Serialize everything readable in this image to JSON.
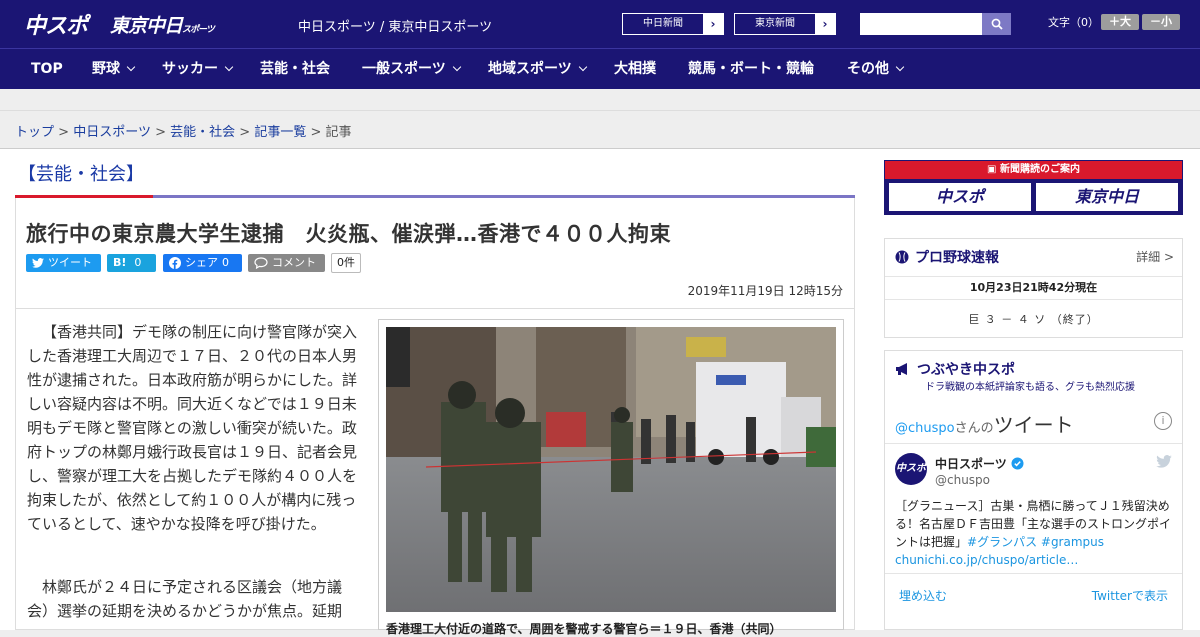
{
  "header": {
    "logo_chuspo": "中スポ",
    "logo_tokyo": "東京中日",
    "logo_tokyo_small": "スポーツ",
    "site_name": "中日スポーツ / 東京中日スポーツ",
    "ext_links": [
      "中日新聞",
      "東京新聞"
    ],
    "search_placeholder": "",
    "font_label": "文字（0）",
    "font_plus": "＋大",
    "font_minus": "－小"
  },
  "nav": {
    "items": [
      {
        "label": "TOP",
        "dropdown": false
      },
      {
        "label": "野球",
        "dropdown": true
      },
      {
        "label": "サッカー",
        "dropdown": true
      },
      {
        "label": "芸能・社会",
        "dropdown": false
      },
      {
        "label": "一般スポーツ",
        "dropdown": true
      },
      {
        "label": "地域スポーツ",
        "dropdown": true
      },
      {
        "label": "大相撲",
        "dropdown": false
      },
      {
        "label": "競馬・ボート・競輪",
        "dropdown": false
      },
      {
        "label": "その他",
        "dropdown": true
      }
    ]
  },
  "breadcrumb": {
    "items": [
      "トップ",
      "中日スポーツ",
      "芸能・社会",
      "記事一覧"
    ],
    "current": "記事",
    "sep": ">"
  },
  "article": {
    "category": "【芸能・社会】",
    "headline": "旅行中の東京農大学生逮捕　火炎瓶、催涙弾…香港で４００人拘束",
    "share": {
      "tweet": "ツイート",
      "hatena": "B!",
      "hatena_count": "0",
      "facebook": "シェア",
      "facebook_count": "0",
      "comment": "コメント",
      "comment_count": "0件"
    },
    "date": "2019年11月19日 12時15分",
    "para1": "【香港共同】デモ隊の制圧に向け警官隊が突入した香港理工大周辺で１７日、２０代の日本人男性が逮捕された。日本政府筋が明らかにした。詳しい容疑内容は不明。同大近くなどでは１９日未明もデモ隊と警官隊との激しい衝突が続いた。政府トップの林鄭月娥行政長官は１９日、記者会見し、警察が理工大を占拠したデモ隊約４００人を拘束したが、依然として約１００人が構内に残っているとして、速やかな投降を呼び掛けた。",
    "para2": "林鄭氏が２４日に予定される区議会（地方議会）選挙の延期を決めるかどうかが焦点。延期",
    "caption": "香港理工大付近の道路で、周囲を警戒する警官ら＝１９日、香港（共同）"
  },
  "sidebar": {
    "promo_head": "新聞購読のご案内",
    "promo_a": "中スポ",
    "promo_b": "東京中日",
    "baseball": {
      "title": "プロ野球速報",
      "more": "詳細 >",
      "time": "10月23日21時42分現在",
      "game": "巨 ３ － ４ ソ （終了）"
    },
    "tsubu": {
      "title": "つぶやき中スポ",
      "subtitle": "ドラ戦観の本紙評論家も語る、グラも熱烈応援",
      "handle_link": "@chuspo",
      "handle_suffix": "さんの",
      "tweet_word": "ツイート",
      "info": "i",
      "avatar": "中スポ",
      "name": "中日スポーツ",
      "handle": "@chuspo",
      "text": "［グラニュース］古巣・鳥栖に勝ってＪ１残留決める！名古屋ＤＦ吉田豊「主な選手のストロングポイントは把握」",
      "hashtags": "#グランパス #grampus",
      "link": "chunichi.co.jp/chuspo/article…",
      "embed": "埋め込む",
      "view": "Twitterで表示"
    }
  },
  "colors": {
    "brand": "#1b1574",
    "accent_red": "#d9192c",
    "link": "#1a3d9e",
    "twitter": "#1d9bf0"
  }
}
